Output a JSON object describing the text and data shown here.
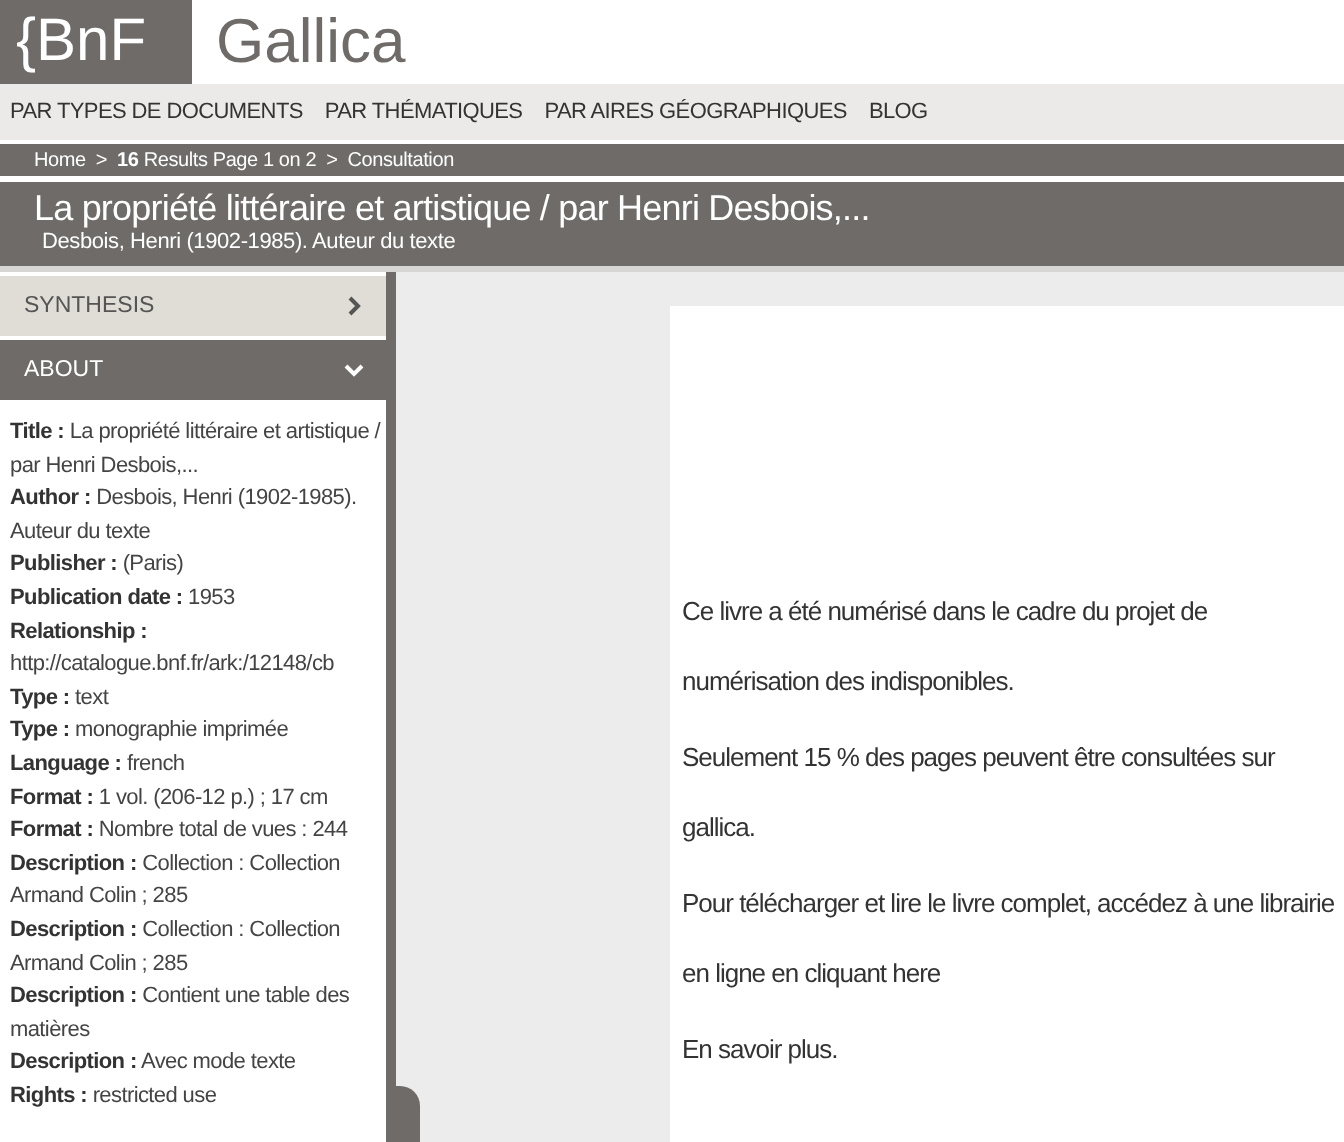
{
  "header": {
    "logo": "{BnF",
    "site_name": "Gallica"
  },
  "nav": [
    "PAR TYPES DE DOCUMENTS",
    "PAR THÉMATIQUES",
    "PAR AIRES GÉOGRAPHIQUES",
    "BLOG"
  ],
  "breadcrumb": [
    {
      "text": "Home",
      "kind": "link"
    },
    {
      "text": ">",
      "kind": "separator"
    },
    {
      "text": "**16** Results Page 1 on 2",
      "kind": "link"
    },
    {
      "text": ">",
      "kind": "separator"
    },
    {
      "text": "Consultation",
      "kind": "link"
    }
  ],
  "document": {
    "title": "La propriété littéraire et artistique / par Henri Desbois,...",
    "author": "Desbois, Henri (1902-1985). Auteur du texte"
  },
  "sidebar": {
    "sections": [
      {
        "label": "SYNTHESIS",
        "expanded": false
      },
      {
        "label": "ABOUT",
        "expanded": true
      }
    ],
    "metadata": [
      {
        "label": "Title :",
        "value": "La propriété littéraire et artistique / par Henri Desbois,..."
      },
      {
        "label": "Author :",
        "value": "Desbois, Henri (1902-1985). Auteur du texte"
      },
      {
        "label": "Publisher :",
        "value": "(Paris)"
      },
      {
        "label": "Publication date :",
        "value": "1953"
      },
      {
        "label": "Relationship :",
        "value": "http://catalogue.bnf.fr/ark:/12148/cb"
      },
      {
        "label": "Type :",
        "value": "text"
      },
      {
        "label": "Type :",
        "value": "monographie imprimée"
      },
      {
        "label": "Language :",
        "value": "french"
      },
      {
        "label": "Format :",
        "value": "1 vol. (206-12 p.) ; 17 cm"
      },
      {
        "label": "Format :",
        "value": "Nombre total de vues : 244"
      },
      {
        "label": "Description :",
        "value": "Collection : Collection Armand Colin ; 285"
      },
      {
        "label": "Description :",
        "value": "Collection : Collection Armand Colin ; 285"
      },
      {
        "label": "Description :",
        "value": "Contient une table des matières"
      },
      {
        "label": "Description :",
        "value": "Avec mode texte"
      },
      {
        "label": "Rights :",
        "value": "restricted use"
      }
    ]
  },
  "notice": [
    "Ce livre a été numérisé dans le cadre du projet de numérisation des indisponibles.",
    "Seulement 15 % des pages peuvent être consultées sur gallica.",
    "Pour télécharger et lire le livre complet, accédez à une librairie en ligne en cliquant here",
    "En savoir plus."
  ]
}
